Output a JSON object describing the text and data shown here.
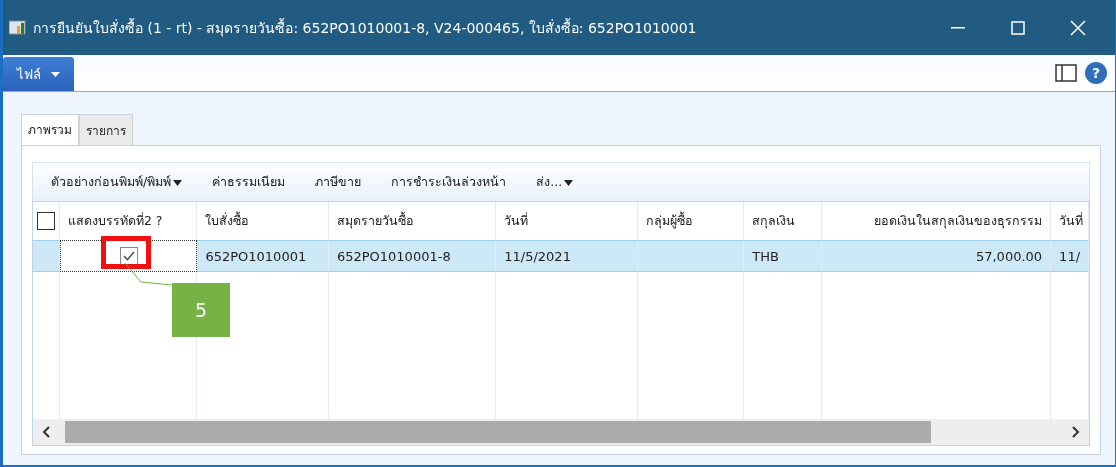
{
  "window": {
    "title": "การยืนยันใบสั่งซื้อ (1 - rt) - สมุดรายวันซื้อ: 652PO1010001-8, V24-000465, ใบสั่งซื้อ: 652PO1010001"
  },
  "menu": {
    "file_button": "ไฟล์",
    "help_button": "?"
  },
  "tabs": [
    {
      "label": "ภาพรวม",
      "selected": true
    },
    {
      "label": "รายการ",
      "selected": false
    }
  ],
  "toolbar": [
    {
      "label": "ตัวอย่างก่อนพิมพ์/พิมพ์",
      "dropdown": true
    },
    {
      "label": "ค่าธรรมเนียม",
      "dropdown": false
    },
    {
      "label": "ภาษีขาย",
      "dropdown": false
    },
    {
      "label": "การชำระเงินล่วงหน้า",
      "dropdown": false
    },
    {
      "label": "ส่ง...",
      "dropdown": true
    }
  ],
  "table": {
    "select_all_checked": false,
    "columns": [
      {
        "label": "แสดงบรรทัดที่2 ?",
        "kind": "checkbox"
      },
      {
        "label": "ใบสั่งซื้อ",
        "kind": "text"
      },
      {
        "label": "สมุดรายวันซื้อ",
        "kind": "text"
      },
      {
        "label": "วันที่",
        "kind": "text"
      },
      {
        "label": "กลุ่มผู้ซื้อ",
        "kind": "text"
      },
      {
        "label": "สกุลเงิน",
        "kind": "text"
      },
      {
        "label": "ยอดเงินในสกุลเงินของธุรกรรม",
        "kind": "number"
      },
      {
        "label": "วันที่",
        "kind": "text"
      }
    ],
    "rows": [
      {
        "selected": true,
        "cells": [
          {
            "checked": true
          },
          {
            "text": "652PO1010001"
          },
          {
            "text": "652PO1010001-8"
          },
          {
            "text": "11/5/2021"
          },
          {},
          {
            "text": "THB"
          },
          {
            "text": "57,000.00"
          },
          {
            "text": "11/"
          }
        ]
      }
    ]
  },
  "callout": {
    "label": "5"
  }
}
